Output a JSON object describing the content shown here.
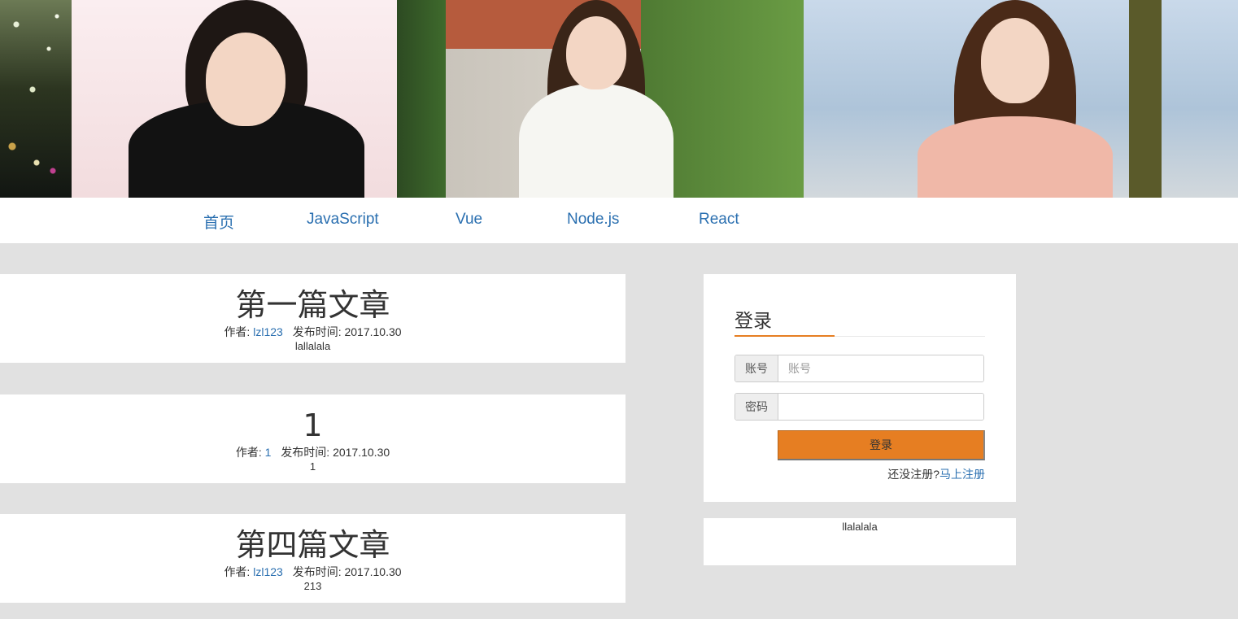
{
  "nav": {
    "items": [
      {
        "label": "首页"
      },
      {
        "label": "JavaScript"
      },
      {
        "label": "Vue"
      },
      {
        "label": "Node.js"
      },
      {
        "label": "React"
      }
    ]
  },
  "articles": [
    {
      "title": "第一篇文章",
      "author_label": "作者:",
      "author": "lzl123",
      "date_label": "发布时间:",
      "date": "2017.10.30",
      "excerpt": "lallalala"
    },
    {
      "title": "1",
      "author_label": "作者:",
      "author": "1",
      "date_label": "发布时间:",
      "date": "2017.10.30",
      "excerpt": "1"
    },
    {
      "title": "第四篇文章",
      "author_label": "作者:",
      "author": "lzl123",
      "date_label": "发布时间:",
      "date": "2017.10.30",
      "excerpt": "213"
    }
  ],
  "login": {
    "title": "登录",
    "account_label": "账号",
    "account_placeholder": "账号",
    "password_label": "密码",
    "submit_label": "登录",
    "register_prompt": "还没注册?",
    "register_link": "马上注册"
  },
  "sidebox": {
    "text": "llalalala"
  },
  "colors": {
    "accent": "#e67e22",
    "link": "#2a6fb0",
    "background": "#e1e1e1"
  }
}
